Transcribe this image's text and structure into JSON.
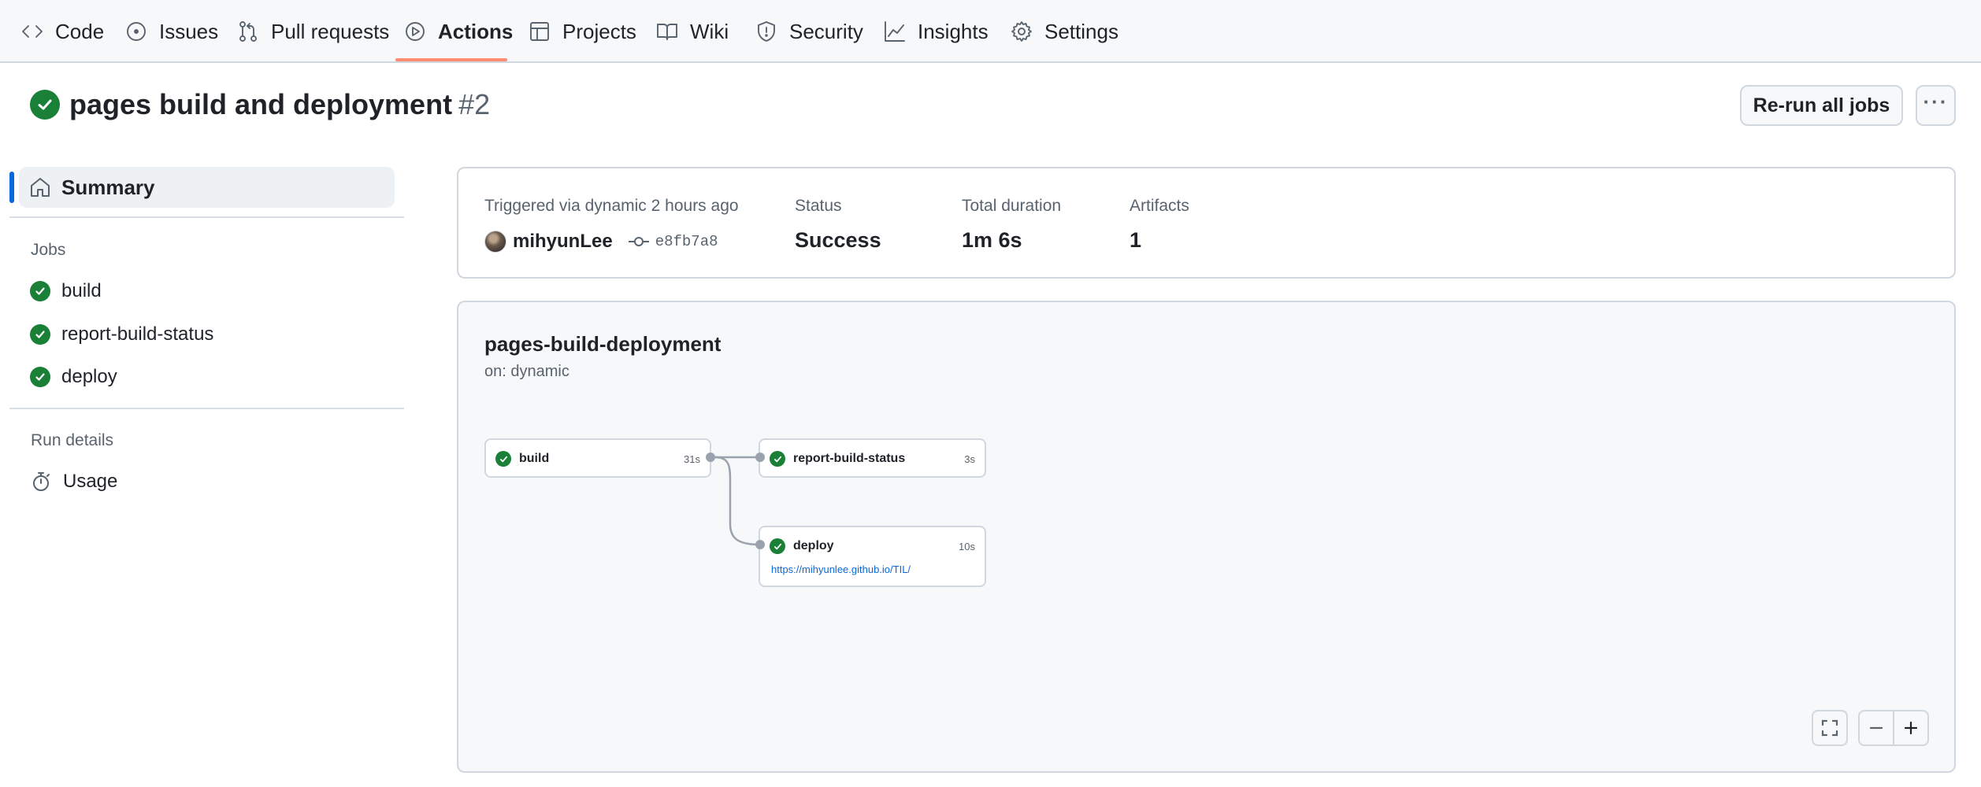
{
  "nav": {
    "items": [
      {
        "label": "Code",
        "icon": "code-icon"
      },
      {
        "label": "Issues",
        "icon": "issue-opened-icon"
      },
      {
        "label": "Pull requests",
        "icon": "git-pull-request-icon"
      },
      {
        "label": "Actions",
        "icon": "play-icon"
      },
      {
        "label": "Projects",
        "icon": "table-icon"
      },
      {
        "label": "Wiki",
        "icon": "book-icon"
      },
      {
        "label": "Security",
        "icon": "shield-icon"
      },
      {
        "label": "Insights",
        "icon": "graph-icon"
      },
      {
        "label": "Settings",
        "icon": "gear-icon"
      }
    ],
    "active": "Actions"
  },
  "header": {
    "title": "pages build and deployment",
    "run_number": "#2",
    "rerun_label": "Re-run all jobs",
    "more_label": "···"
  },
  "sidebar": {
    "summary_label": "Summary",
    "jobs_heading": "Jobs",
    "jobs": [
      {
        "label": "build"
      },
      {
        "label": "report-build-status"
      },
      {
        "label": "deploy"
      }
    ],
    "run_details_heading": "Run details",
    "usage_label": "Usage"
  },
  "summary": {
    "trigger_text": "Triggered via dynamic 2 hours ago",
    "actor": "mihyunLee",
    "commit_sha": "e8fb7a8",
    "status_label": "Status",
    "status_value": "Success",
    "duration_label": "Total duration",
    "duration_value": "1m 6s",
    "artifacts_label": "Artifacts",
    "artifacts_value": "1"
  },
  "graph": {
    "workflow_name": "pages-build-deployment",
    "trigger": "on: dynamic",
    "jobs": [
      {
        "name": "build",
        "duration": "31s"
      },
      {
        "name": "report-build-status",
        "duration": "3s"
      },
      {
        "name": "deploy",
        "duration": "10s",
        "link": "https://mihyunlee.github.io/TIL/"
      }
    ]
  },
  "colors": {
    "success": "#1a7f37",
    "accent": "#0969da",
    "nav_underline": "#fd8c73"
  }
}
